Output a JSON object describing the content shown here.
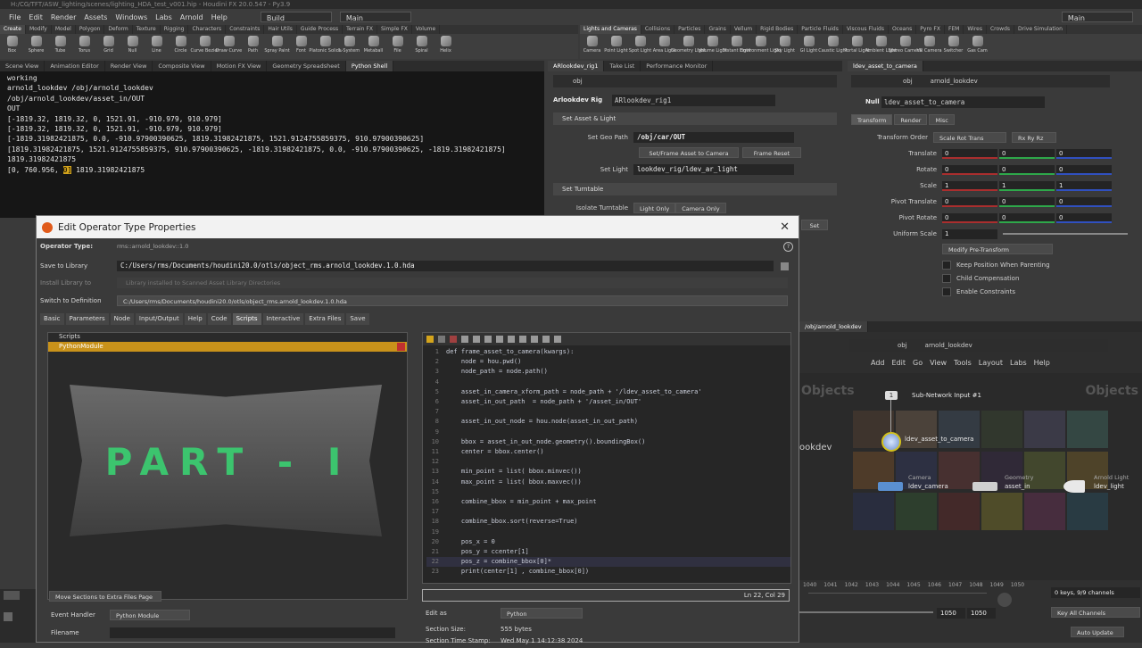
{
  "titlebar": {
    "text": "H:/CG/TFT/ASW_lighting/scenes/lighting_HDA_test_v001.hip - Houdini FX 20.0.547 - Py3.9"
  },
  "menu": {
    "items": [
      "File",
      "Edit",
      "Render",
      "Assets",
      "Windows",
      "Labs",
      "Arnold",
      "Help"
    ],
    "desktop_left": "Build",
    "desktop_mid": "Main",
    "desktop_right": "Main"
  },
  "shelf_left": {
    "tabs": [
      "Create",
      "Modify",
      "Model",
      "Polygon",
      "Deform",
      "Texture",
      "Rigging",
      "Characters",
      "Constraints",
      "Hair Utils",
      "Guide Process",
      "Terrain FX",
      "Simple FX",
      "Volume"
    ],
    "tools": [
      "Box",
      "Sphere",
      "Tube",
      "Torus",
      "Grid",
      "Null",
      "Line",
      "Circle",
      "Curve Bezier",
      "Draw Curve",
      "Path",
      "Spray Paint",
      "Font",
      "Platonic Solids",
      "L-System",
      "Metaball",
      "File",
      "Spiral",
      "Helix"
    ]
  },
  "shelf_right": {
    "tabs": [
      "Lights and Cameras",
      "Collisions",
      "Particles",
      "Grains",
      "Vellum",
      "Rigid Bodies",
      "Particle Fluids",
      "Viscous Fluids",
      "Oceans",
      "Pyro FX",
      "FEM",
      "Wires",
      "Crowds",
      "Drive Simulation"
    ],
    "tools": [
      "Camera",
      "Point Light",
      "Spot Light",
      "Area Light",
      "Geometry Light",
      "Volume Light",
      "Distant Light",
      "Environment Light",
      "Sky Light",
      "GI Light",
      "Caustic Light",
      "Portal Light",
      "Ambient Light",
      "Stereo Camera",
      "VR Camera",
      "Switcher",
      "Gas Cam"
    ]
  },
  "left_pane": {
    "tabs": [
      "Scene View",
      "Animation Editor",
      "Render View",
      "Composite View",
      "Motion FX View",
      "Geometry Spreadsheet",
      "Python Shell"
    ],
    "shell_lines": [
      "working",
      "arnold_lookdev /obj/arnold_lookdev",
      "/obj/arnold_lookdev/asset_in/OUT",
      "OUT",
      "[-1819.32, 1819.32, 0, 1521.91, -910.979, 910.979]",
      "[-1819.32, 1819.32, 0, 1521.91, -910.979, 910.979]",
      "[-1819.31982421875, 0.0, -910.97900390625, 1819.31982421875, 1521.9124755859375, 910.97900390625]",
      "[1819.31982421875, 1521.9124755859375, 910.97900390625, -1819.31982421875, 0.0, -910.97900390625, -1819.31982421875]",
      "1819.31982421875"
    ],
    "shell_last_prefix": "[0, 760.956, ",
    "shell_last_highlight": "0]",
    "shell_last_suffix": " 1819.31982421875"
  },
  "mid_pane": {
    "tabs": [
      "ARlookdev_rig1",
      "Take List",
      "Performance Monitor"
    ],
    "path": "obj",
    "node_type": "Arlookdev Rig",
    "node_name": "ARlookdev_rig1",
    "section1": "Set Asset & Light",
    "set_geo_path_label": "Set Geo Path",
    "set_geo_path_value": "/obj/car/OUT",
    "btn_frame_cam": "Set/Frame Asset to Camera",
    "btn_frame_reset": "Frame Reset",
    "set_light_label": "Set Light",
    "set_light_value": "lookdev_rig/ldev_ar_light",
    "section2": "Set Turntable",
    "isolate_label": "Isolate Turntable",
    "light_only": "Light Only",
    "camera_only": "Camera Only",
    "set_label": "Set"
  },
  "right_pane": {
    "tabs": [
      "ldev_asset_to_camera"
    ],
    "path1": "obj",
    "path2": "arnold_lookdev",
    "node_type": "Null",
    "node_name": "ldev_asset_to_camera",
    "subtabs": [
      "Transform",
      "Render",
      "Misc"
    ],
    "transform_order_label": "Transform Order",
    "transform_order_value": "Scale Rot Trans",
    "rot_order_value": "Rx Ry Rz",
    "rows": [
      {
        "label": "Translate",
        "values": [
          "0",
          "0",
          "0"
        ]
      },
      {
        "label": "Rotate",
        "values": [
          "0",
          "0",
          "0"
        ]
      },
      {
        "label": "Scale",
        "values": [
          "1",
          "1",
          "1"
        ]
      },
      {
        "label": "Pivot Translate",
        "values": [
          "0",
          "0",
          "0"
        ]
      },
      {
        "label": "Pivot Rotate",
        "values": [
          "0",
          "0",
          "0"
        ]
      }
    ],
    "uniform_scale_label": "Uniform Scale",
    "uniform_scale_value": "1",
    "modify_pre": "Modify Pre-Transform",
    "checks": [
      "Keep Position When Parenting",
      "Child Compensation",
      "Enable Constraints"
    ]
  },
  "network": {
    "tab": "/obj/arnold_lookdev",
    "path1": "obj",
    "path2": "arnold_lookdev",
    "menu": [
      "Add",
      "Edit",
      "Go",
      "View",
      "Tools",
      "Layout",
      "Labs",
      "Help"
    ],
    "watermark": "Objects",
    "partial_text": "ookdev",
    "nodes": {
      "subnet_index": "1",
      "subnet_input": "Sub-Network Input #1",
      "asset_to_cam": "ldev_asset_to_camera",
      "camera_type": "Camera",
      "camera": "ldev_camera",
      "geo_type": "Geometry",
      "asset_in": "asset_in",
      "light_type": "Arnold Light",
      "light": "ldev_light"
    }
  },
  "timeline": {
    "ticks": [
      "1040",
      "1041",
      "1042",
      "1043",
      "1044",
      "1045",
      "1046",
      "1047",
      "1048",
      "1049",
      "1050"
    ],
    "frame_end": "1050",
    "frame_end2": "1050",
    "keys_text": "0 keys, 9/9 channels",
    "key_all": "Key All Channels",
    "auto_update": "Auto Update"
  },
  "dialog": {
    "title": "Edit Operator Type Properties",
    "operator_type_label": "Operator Type:",
    "operator_type_value": "rms::arnold_lookdev::1.0",
    "save_label": "Save to Library",
    "save_value": "C:/Users/rms/Documents/houdini20.0/otls/object_rms.arnold_lookdev.1.0.hda",
    "install_label": "Install Library to",
    "install_value": "Library installed to Scanned Asset Library Directories",
    "switch_label": "Switch to Definition",
    "switch_value": "C:/Users/rms/Documents/houdini20.0/otls/object_rms.arnold_lookdev.1.0.hda",
    "tabs": [
      "Basic",
      "Parameters",
      "Node",
      "Input/Output",
      "Help",
      "Code",
      "Scripts",
      "Interactive",
      "Extra Files",
      "Save"
    ],
    "scripts_header": "Scripts",
    "scripts_item": "PythonModule",
    "overlay_text": "PART - I",
    "code_lines": [
      {
        "n": "1",
        "t": "def frame_asset_to_camera(kwargs):"
      },
      {
        "n": "2",
        "t": "    node = hou.pwd()"
      },
      {
        "n": "3",
        "t": "    node_path = node.path()"
      },
      {
        "n": "4",
        "t": ""
      },
      {
        "n": "5",
        "t": "    asset_in_camera_xform_path = node_path + '/ldev_asset_to_camera'"
      },
      {
        "n": "6",
        "t": "    asset_in_out_path  = node_path + '/asset_in/OUT'"
      },
      {
        "n": "7",
        "t": ""
      },
      {
        "n": "8",
        "t": "    asset_in_out_node = hou.node(asset_in_out_path)"
      },
      {
        "n": "9",
        "t": ""
      },
      {
        "n": "10",
        "t": "    bbox = asset_in_out_node.geometry().boundingBox()"
      },
      {
        "n": "11",
        "t": "    center = bbox.center()"
      },
      {
        "n": "12",
        "t": ""
      },
      {
        "n": "13",
        "t": "    min_point = list( bbox.minvec())"
      },
      {
        "n": "14",
        "t": "    max_point = list( bbox.maxvec())"
      },
      {
        "n": "15",
        "t": ""
      },
      {
        "n": "16",
        "t": "    combine_bbox = min_point + max_point"
      },
      {
        "n": "17",
        "t": ""
      },
      {
        "n": "18",
        "t": "    combine_bbox.sort(reverse=True)"
      },
      {
        "n": "19",
        "t": ""
      },
      {
        "n": "20",
        "t": "    pos_x = 0"
      },
      {
        "n": "21",
        "t": "    pos_y = ccenter[1]"
      },
      {
        "n": "22",
        "t": "    pos_z = combine_bbox[0]*"
      },
      {
        "n": "23",
        "t": "    print(center[1] , combine_bbox[0])"
      }
    ],
    "cursor_pos": "Ln 22, Col 29",
    "move_sections": "Move Sections to Extra Files Page",
    "event_handler_label": "Event Handler",
    "event_handler_value": "Python Module",
    "filename_label": "Filename",
    "edit_as_label": "Edit as",
    "edit_as_value": "Python",
    "section_size_label": "Section Size:",
    "section_size_value": "555 bytes",
    "section_time_label": "Section Time Stamp:",
    "section_time_value": "Wed May 1 14:12:38 2024"
  },
  "colors": {
    "accent_orange": "#d4a41c",
    "part_green": "#3cc46e",
    "dialog_title_bg": "#f2f2f2"
  }
}
